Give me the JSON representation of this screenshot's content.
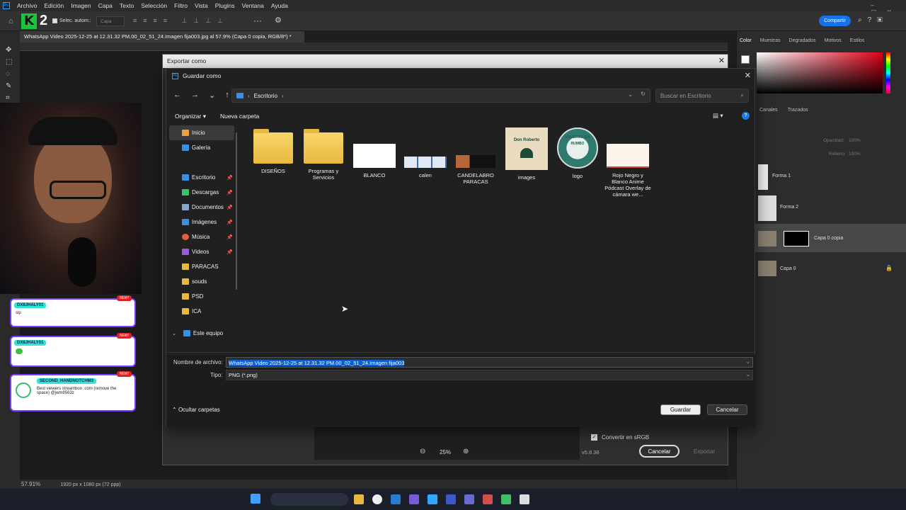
{
  "app": {
    "menu": [
      "Archivo",
      "Edición",
      "Imagen",
      "Capa",
      "Texto",
      "Selección",
      "Filtro",
      "Vista",
      "Plugins",
      "Ventana",
      "Ayuda"
    ],
    "option_select_label": "Selec. autom.:",
    "option_layer": "Capa",
    "share_button": "Compartir",
    "doc_tab": "WhatsApp Video 2025-12-25 at 12.31.32 PM.00_02_51_24.Imagen fija003.jpg al 57.9% (Capa 0 copia, RGB/8*) *",
    "zoom_status": "57.91%",
    "dimensions_status": "1920 px x 1080 px (72 ppp)"
  },
  "right_panel": {
    "tabs": [
      "Color",
      "Muestras",
      "Degradados",
      "Motivos",
      "Estilos"
    ],
    "layer_tabs": [
      "Canales",
      "Trazados"
    ],
    "opacity_label": "Opacidad:",
    "opacity_value": "100%",
    "fill_label": "Relleno:",
    "fill_value": "100%",
    "layers": [
      "Forma 1",
      "Forma 2",
      "Capa 0 copia",
      "Capa 0"
    ]
  },
  "chat": [
    {
      "user": "DX8JHALY01",
      "msg": "sip",
      "badge": "NEW!"
    },
    {
      "user": "DX8JHALY01",
      "msg": "",
      "badge": "NEW!"
    },
    {
      "user": "SECOND_HANDNOTCHM3",
      "msg": "Best viewers streamboo .com (remove the space) @jwm8563z",
      "badge": "NEW!"
    }
  ],
  "export_dialog": {
    "title": "Exportar como",
    "convert_srgb": "Convertir en sRGB",
    "zoom": "25%",
    "version": "v5.8.38",
    "cancel": "Cancelar",
    "export": "Exportar"
  },
  "save_dialog": {
    "title": "Guardar como",
    "breadcrumb": "Escritorio",
    "search_placeholder": "Buscar en Escritorio",
    "organize": "Organizar",
    "new_folder": "Nueva carpeta",
    "nav": [
      {
        "label": "Inicio",
        "icon": "home-icon",
        "color": "#e8a33a",
        "selected": true
      },
      {
        "label": "Galería",
        "icon": "gallery-icon",
        "color": "#3b8fe0"
      },
      {
        "label": "Escritorio",
        "icon": "desktop-icon",
        "color": "#3b8fe0",
        "pinned": true
      },
      {
        "label": "Descargas",
        "icon": "download-icon",
        "color": "#3fbf6a",
        "pinned": true
      },
      {
        "label": "Documentos",
        "icon": "documents-icon",
        "color": "#8aa4c8",
        "pinned": true
      },
      {
        "label": "Imágenes",
        "icon": "pictures-icon",
        "color": "#3b8fe0",
        "pinned": true
      },
      {
        "label": "Música",
        "icon": "music-icon",
        "color": "#e0603b",
        "pinned": true
      },
      {
        "label": "Videos",
        "icon": "videos-icon",
        "color": "#9b59e0",
        "pinned": true
      },
      {
        "label": "PARACAS",
        "icon": "folder-icon",
        "color": "#e9b93f"
      },
      {
        "label": "souds",
        "icon": "folder-icon",
        "color": "#e9b93f"
      },
      {
        "label": "PSD",
        "icon": "folder-icon",
        "color": "#e9b93f"
      },
      {
        "label": "ICA",
        "icon": "folder-icon",
        "color": "#e9b93f"
      },
      {
        "label": "Este equipo",
        "icon": "computer-icon",
        "color": "#3b8fe0"
      }
    ],
    "files": [
      {
        "label": "DISEÑOS",
        "kind": "folder"
      },
      {
        "label": "Programas y Servicios",
        "kind": "folder"
      },
      {
        "label": "BLANCO",
        "kind": "white"
      },
      {
        "label": "calen",
        "kind": "calendar"
      },
      {
        "label": "CANDELABRO PARACAS",
        "kind": "dark"
      },
      {
        "label": "images",
        "kind": "beige"
      },
      {
        "label": "logo",
        "kind": "logo"
      },
      {
        "label": "Rojo Negro y Blanco Anime Pódcast Overlay de cámara we...",
        "kind": "cream"
      }
    ],
    "thumb_text": {
      "images": "Don Roberto",
      "logo": "VIAJERAS SIN RUMBO"
    },
    "filename_label": "Nombre de archivo:",
    "filename_value": "WhatsApp Video 2025-12-25 at 12.31.32 PM.00_02_51_24.Imagen fija003",
    "type_label": "Tipo:",
    "type_value": "PNG (*.png)",
    "hide_folders": "Ocultar carpetas",
    "save": "Guardar",
    "cancel": "Cancelar"
  }
}
